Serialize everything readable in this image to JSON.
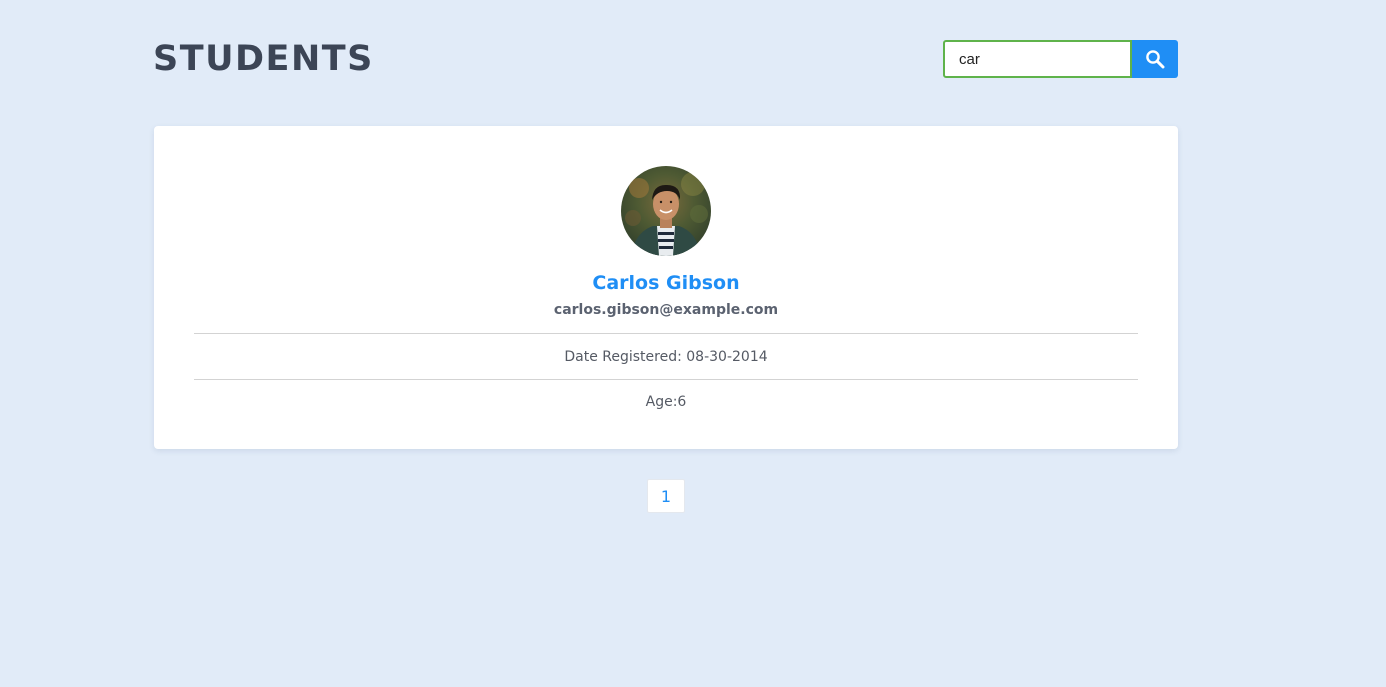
{
  "header": {
    "title": "STUDENTS"
  },
  "search": {
    "value": "car",
    "button_icon": "search-icon"
  },
  "student": {
    "avatar_icon": "avatar-photo",
    "name": "Carlos Gibson",
    "email": "carlos.gibson@example.com",
    "date_registered": "Date Registered: 08-30-2014",
    "age": "Age:6"
  },
  "pagination": {
    "pages": [
      "1"
    ],
    "current": "1"
  },
  "colors": {
    "background": "#e1ebf8",
    "accent": "#1f8ef5",
    "title": "#3c4556",
    "input_border": "#5fb34b"
  }
}
